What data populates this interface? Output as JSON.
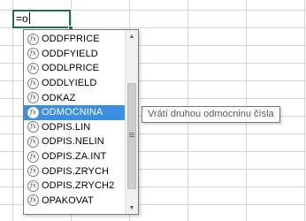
{
  "cell": {
    "value": "=o"
  },
  "autocomplete": {
    "items": [
      {
        "label": "ODDFPRICE",
        "icon": "function-icon"
      },
      {
        "label": "ODDFYIELD",
        "icon": "function-icon"
      },
      {
        "label": "ODDLPRICE",
        "icon": "function-icon"
      },
      {
        "label": "ODDLYIELD",
        "icon": "function-icon"
      },
      {
        "label": "ODKAZ",
        "icon": "function-icon"
      },
      {
        "label": "ODMOCNINA",
        "icon": "function-icon"
      },
      {
        "label": "ODPIS.LIN",
        "icon": "function-icon"
      },
      {
        "label": "ODPIS.NELIN",
        "icon": "function-icon"
      },
      {
        "label": "ODPIS.ZA.INT",
        "icon": "function-icon"
      },
      {
        "label": "ODPIS.ZRYCH",
        "icon": "function-icon"
      },
      {
        "label": "ODPIS.ZRYCH2",
        "icon": "function-icon"
      },
      {
        "label": "OPAKOVAT",
        "icon": "function-icon"
      }
    ],
    "selected_index": 5
  },
  "tooltip": {
    "text": "Vrátí druhou odmocninu čísla"
  },
  "colors": {
    "selection": "#3c8fe0",
    "cell_border": "#217346",
    "gridline": "#d4d4d4"
  }
}
